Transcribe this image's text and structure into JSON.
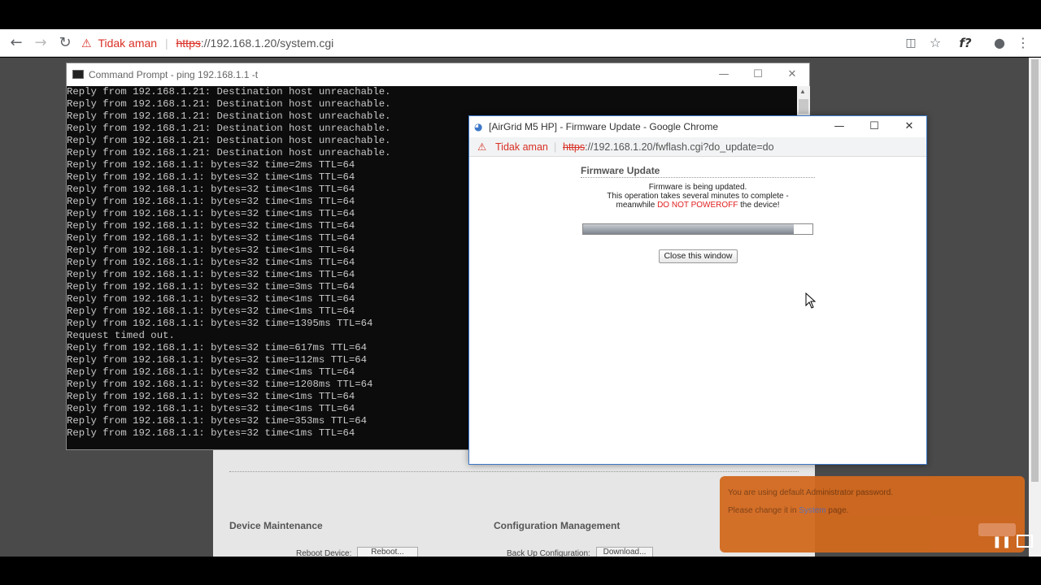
{
  "browser": {
    "security_label": "Tidak aman",
    "url_scheme": "https",
    "url_rest": "://192.168.1.20/system.cgi",
    "icons": [
      "back-icon",
      "forward-icon",
      "reload-icon",
      "warning-icon",
      "translate-icon",
      "star-icon",
      "extension-icon",
      "account-icon",
      "menu-icon"
    ],
    "ext_label": "f?"
  },
  "cmd": {
    "title": "Command Prompt - ping  192.168.1.1 -t",
    "lines": [
      "Reply from 192.168.1.21: Destination host unreachable.",
      "Reply from 192.168.1.21: Destination host unreachable.",
      "Reply from 192.168.1.21: Destination host unreachable.",
      "Reply from 192.168.1.21: Destination host unreachable.",
      "Reply from 192.168.1.21: Destination host unreachable.",
      "Reply from 192.168.1.21: Destination host unreachable.",
      "Reply from 192.168.1.1: bytes=32 time=2ms TTL=64",
      "Reply from 192.168.1.1: bytes=32 time<1ms TTL=64",
      "Reply from 192.168.1.1: bytes=32 time<1ms TTL=64",
      "Reply from 192.168.1.1: bytes=32 time<1ms TTL=64",
      "Reply from 192.168.1.1: bytes=32 time<1ms TTL=64",
      "Reply from 192.168.1.1: bytes=32 time<1ms TTL=64",
      "Reply from 192.168.1.1: bytes=32 time<1ms TTL=64",
      "Reply from 192.168.1.1: bytes=32 time<1ms TTL=64",
      "Reply from 192.168.1.1: bytes=32 time<1ms TTL=64",
      "Reply from 192.168.1.1: bytes=32 time<1ms TTL=64",
      "Reply from 192.168.1.1: bytes=32 time=3ms TTL=64",
      "Reply from 192.168.1.1: bytes=32 time<1ms TTL=64",
      "Reply from 192.168.1.1: bytes=32 time<1ms TTL=64",
      "Reply from 192.168.1.1: bytes=32 time=1395ms TTL=64",
      "Request timed out.",
      "Reply from 192.168.1.1: bytes=32 time=617ms TTL=64",
      "Reply from 192.168.1.1: bytes=32 time=112ms TTL=64",
      "Reply from 192.168.1.1: bytes=32 time<1ms TTL=64",
      "Reply from 192.168.1.1: bytes=32 time=1208ms TTL=64",
      "Reply from 192.168.1.1: bytes=32 time<1ms TTL=64",
      "Reply from 192.168.1.1: bytes=32 time<1ms TTL=64",
      "Reply from 192.168.1.1: bytes=32 time=353ms TTL=64",
      "Reply from 192.168.1.1: bytes=32 time<1ms TTL=64"
    ]
  },
  "popup": {
    "title": "[AirGrid M5 HP] - Firmware Update - Google Chrome",
    "security_label": "Tidak aman",
    "url_scheme": "https",
    "url_rest": "://192.168.1.20/fwflash.cgi?do_update=do",
    "fw_title": "Firmware Update",
    "msg_line1": "Firmware is being updated.",
    "msg_line2": "This operation takes several minutes to complete -",
    "msg_line3_pre": "meanwhile ",
    "msg_warning": "DO NOT POWEROFF",
    "msg_line3_post": " the device!",
    "progress": 0.92,
    "close_label": "Close this window"
  },
  "page": {
    "device_maintenance": "Device Maintenance",
    "config_management": "Configuration Management",
    "reboot_label": "Reboot Device:",
    "reboot_btn": "Reboot...",
    "backup_label": "Back Up Configuration:",
    "download_btn": "Download..."
  },
  "notice": {
    "line1": "You are using default Administrator password.",
    "line2_pre": "Please change it in ",
    "line2_link": "System",
    "line2_post": " page."
  },
  "colors": {
    "warning_red": "#d93025",
    "poweroff_red": "#e02020",
    "notice_orange": "#d2691e",
    "popup_border": "#3c78c8"
  }
}
